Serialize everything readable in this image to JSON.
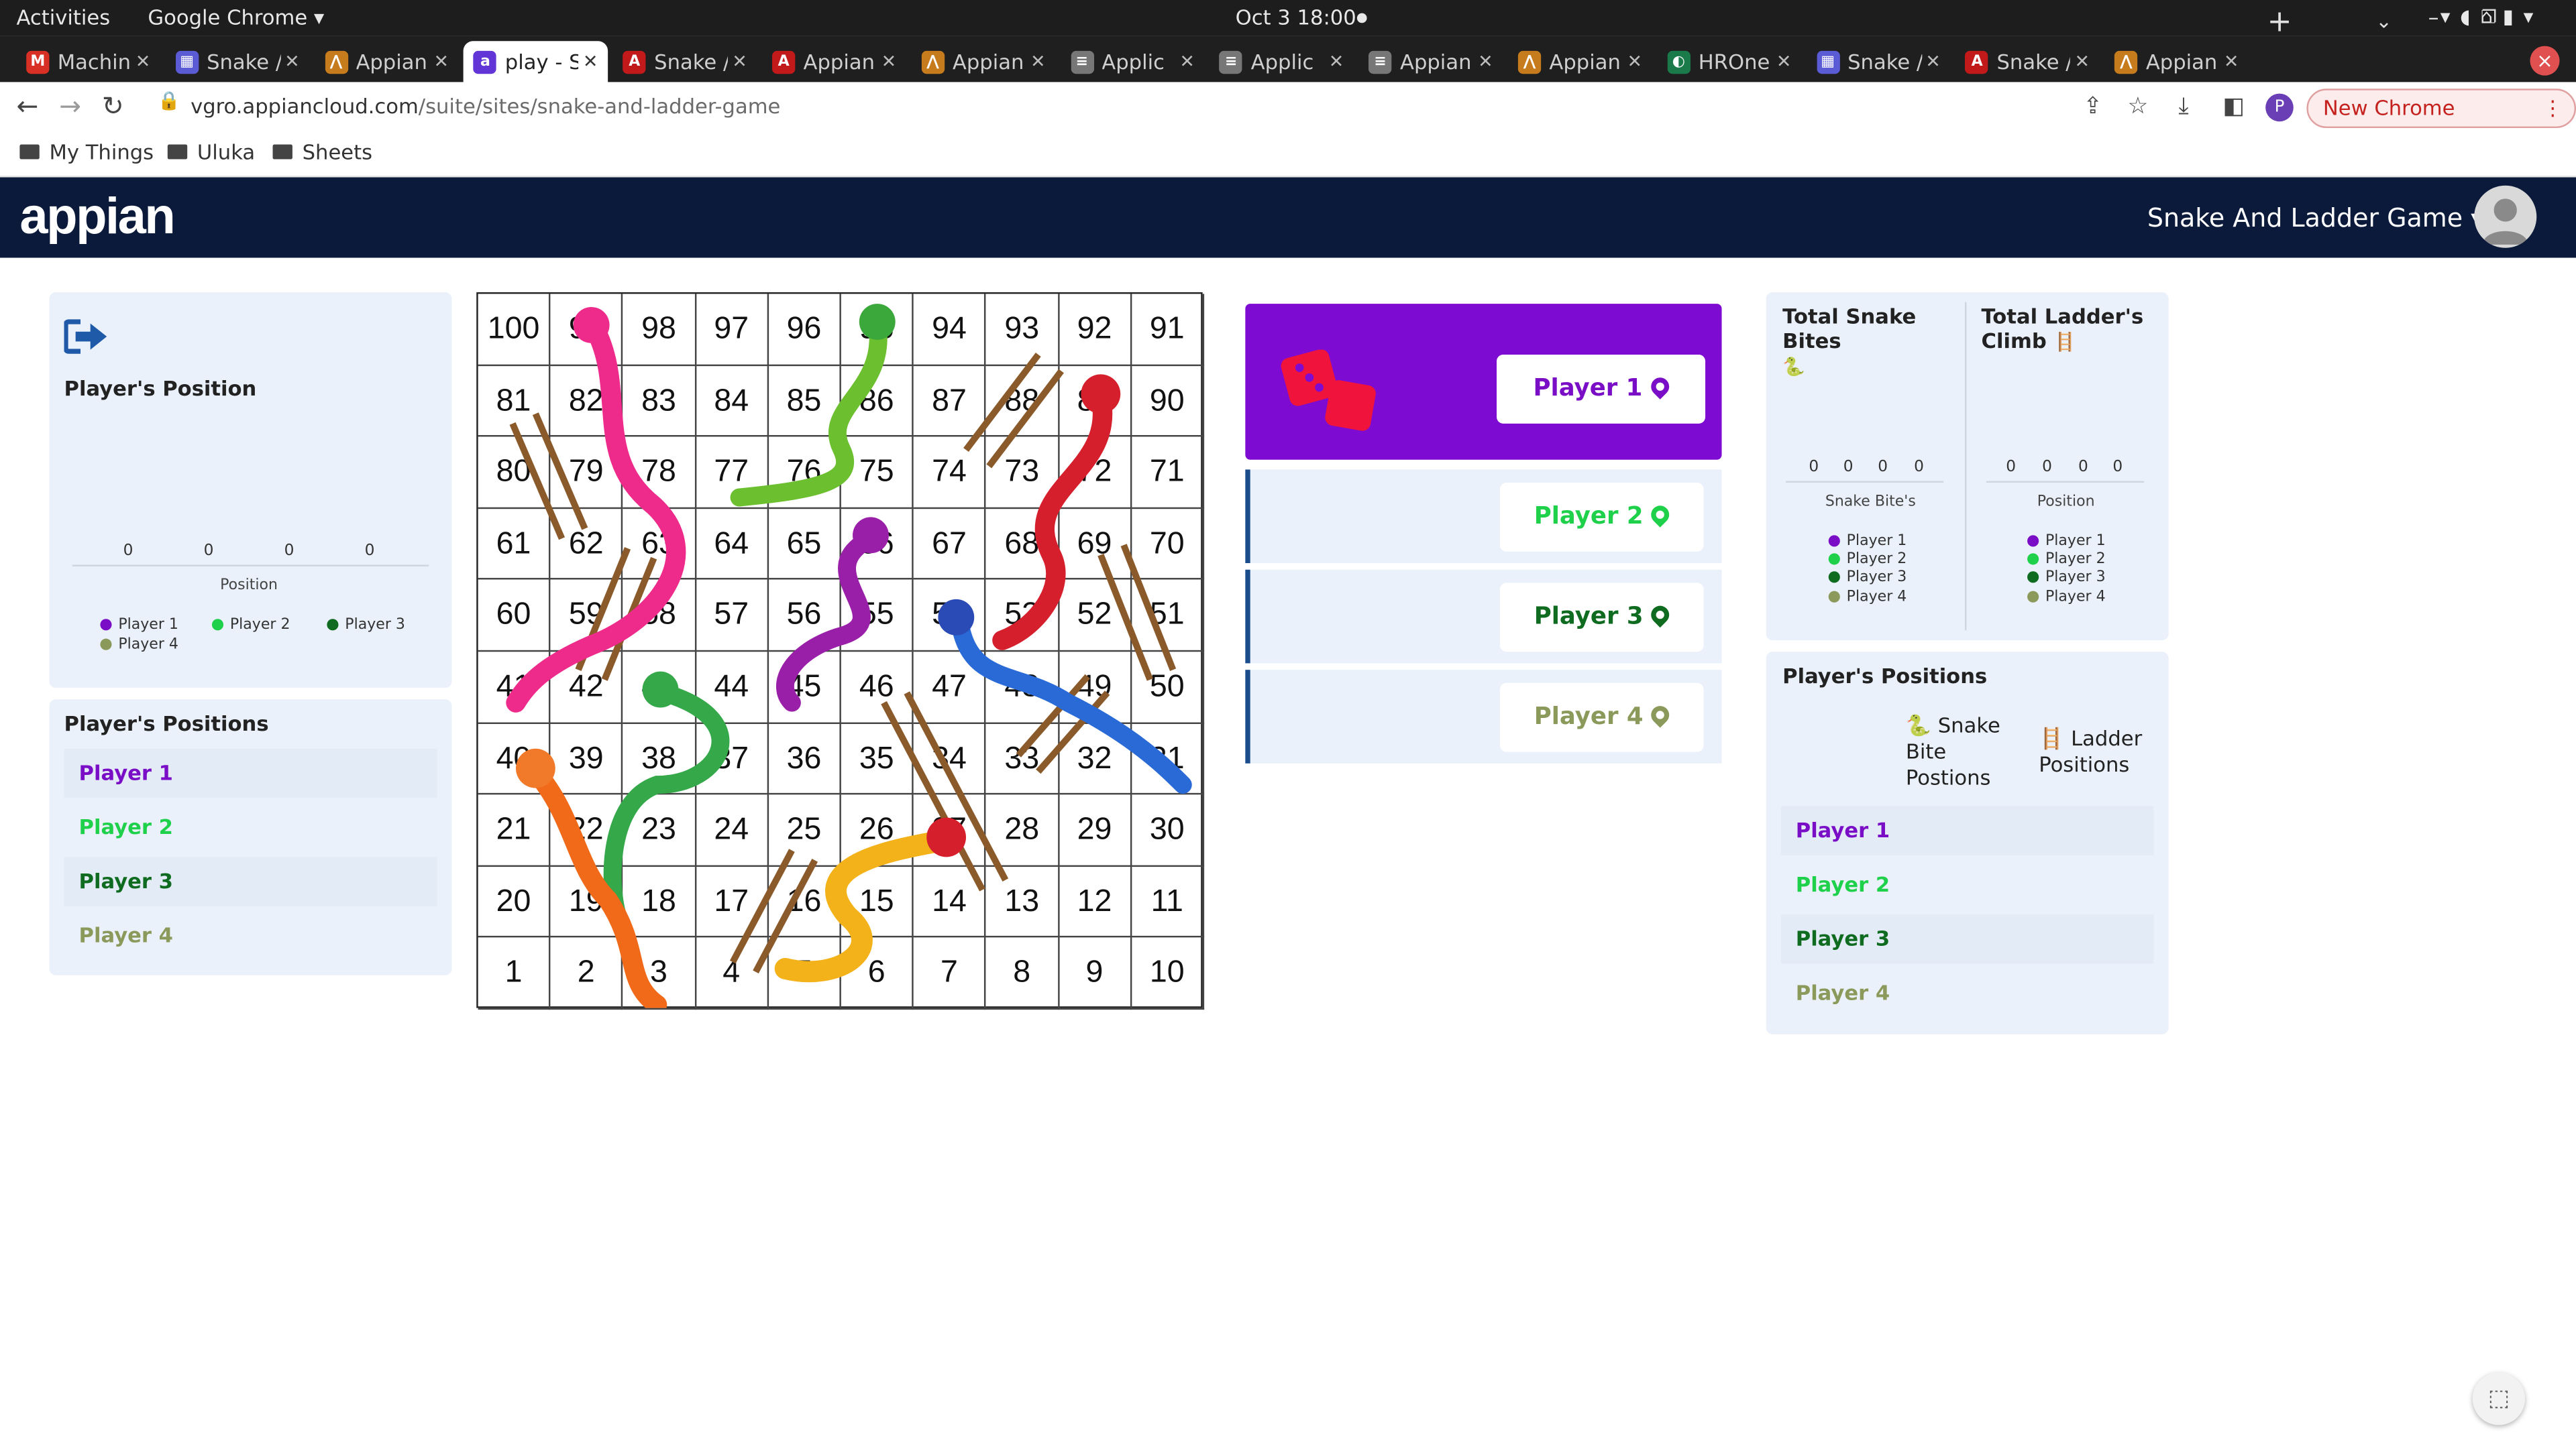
{
  "system": {
    "activities": "Activities",
    "app_name": "Google Chrome ▾",
    "clock": "Oct 3  18:00"
  },
  "browser": {
    "tabs": [
      {
        "title": "Machin",
        "icon": "gmail-icon",
        "color": "#d93025",
        "glyph": "M"
      },
      {
        "title": "Snake /",
        "icon": "grid-app-icon",
        "color": "#5b5bd6",
        "glyph": "▦"
      },
      {
        "title": "Appian",
        "icon": "appian-icon",
        "color": "#c67b1c",
        "glyph": "⋀"
      },
      {
        "title": "play - S",
        "icon": "appian-a-icon",
        "color": "#6236d6",
        "glyph": "a"
      },
      {
        "title": "Snake /",
        "icon": "acrobat-icon",
        "color": "#c21a1a",
        "glyph": "A"
      },
      {
        "title": "Appian",
        "icon": "acrobat-icon",
        "color": "#c21a1a",
        "glyph": "A"
      },
      {
        "title": "Appian",
        "icon": "appian-icon",
        "color": "#c67b1c",
        "glyph": "⋀"
      },
      {
        "title": "Applic",
        "icon": "doc-icon",
        "color": "#777777",
        "glyph": "≡"
      },
      {
        "title": "Applic",
        "icon": "doc-icon",
        "color": "#777777",
        "glyph": "≡"
      },
      {
        "title": "Appian",
        "icon": "doc-icon",
        "color": "#777777",
        "glyph": "≡"
      },
      {
        "title": "Appian",
        "icon": "appian-icon",
        "color": "#c67b1c",
        "glyph": "⋀"
      },
      {
        "title": "HROne",
        "icon": "hrone-icon",
        "color": "#1a7a4a",
        "glyph": "◐"
      },
      {
        "title": "Snake /",
        "icon": "grid-app-icon",
        "color": "#5b5bd6",
        "glyph": "▦"
      },
      {
        "title": "Snake /",
        "icon": "acrobat-icon",
        "color": "#c21a1a",
        "glyph": "A"
      },
      {
        "title": "Appian",
        "icon": "appian-icon",
        "color": "#c67b1c",
        "glyph": "⋀"
      }
    ],
    "active_tab": 3,
    "url_host": "vgro.appiancloud.com",
    "url_path": "/suite/sites/snake-and-ladder-game",
    "update_label": "New Chrome available",
    "bookmarks": [
      "My Things",
      "Uluka",
      "Sheets"
    ]
  },
  "header": {
    "logo": "appian",
    "site_title": "Snake And Ladder Game ▾"
  },
  "left_panel": {
    "title": "Player's Position",
    "values": [
      "0",
      "0",
      "0",
      "0"
    ],
    "axis_label": "Position",
    "legend": [
      "Player 1",
      "Player 2",
      "Player 3",
      "Player 4"
    ]
  },
  "players": [
    {
      "name": "Player 1",
      "color": "#7a0ec7"
    },
    {
      "name": "Player 2",
      "color": "#1fd14a"
    },
    {
      "name": "Player 3",
      "color": "#0e6b1f"
    },
    {
      "name": "Player 4",
      "color": "#8b9a5b"
    }
  ],
  "left_positions": {
    "title": "Player's Positions"
  },
  "player_cards": {
    "active_color": "#7d0bd1",
    "dice_color": "#f0143c"
  },
  "stats": {
    "snake_title": "Total Snake Bites",
    "snake_icon": "🐍",
    "ladder_title": "Total Ladder's Climb",
    "ladder_icon": "🪜",
    "snake_values": [
      "0",
      "0",
      "0",
      "0"
    ],
    "ladder_values": [
      "0",
      "0",
      "0",
      "0"
    ],
    "snake_axis": "Snake Bite's",
    "ladder_axis": "Position"
  },
  "right_positions": {
    "title": "Player's Positions",
    "col_snake": "Snake Bite Postions",
    "col_ladder": "Ladder Positions"
  },
  "board": {
    "cells": 100
  }
}
